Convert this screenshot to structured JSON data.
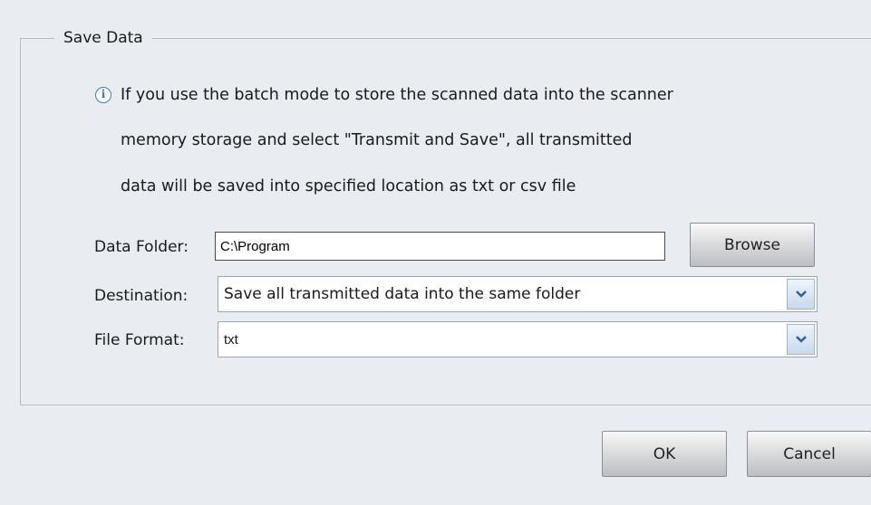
{
  "group": {
    "title": "Save Data"
  },
  "info": {
    "icon": "info-icon",
    "lines": [
      "If you use the batch mode to store the scanned data into the scanner",
      "memory storage and select \"Transmit and Save\", all transmitted",
      "data will be saved into specified location as txt or csv file"
    ]
  },
  "form": {
    "data_folder": {
      "label": "Data Folder:",
      "value": "C:\\Program",
      "browse_label": "Browse"
    },
    "destination": {
      "label": "Destination:",
      "value": "Save all transmitted data into the same folder"
    },
    "file_format": {
      "label": "File Format:",
      "value": "txt"
    }
  },
  "footer": {
    "ok_label": "OK",
    "cancel_label": "Cancel"
  },
  "colors": {
    "background": "#e9edf2",
    "info_icon": "#3b78c9",
    "combo_border": "#9aa6b5"
  }
}
